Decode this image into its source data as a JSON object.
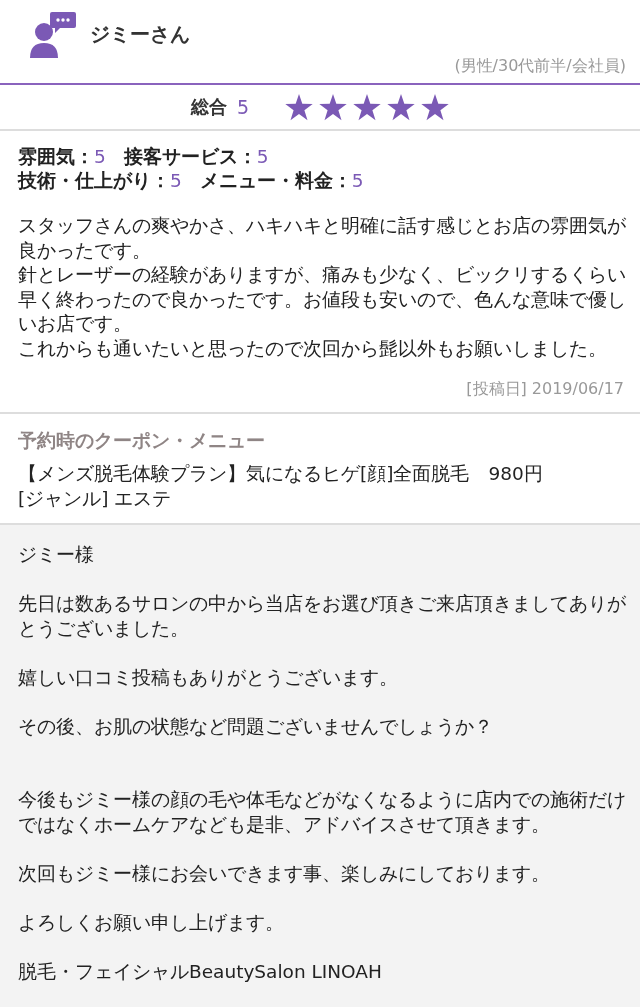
{
  "reviewer": {
    "name": "ジミーさん",
    "profile": "(男性/30代前半/会社員)"
  },
  "overall": {
    "label": "総合",
    "score": "5",
    "stars": 5
  },
  "ratings": [
    {
      "label": "雰囲気：",
      "value": "5"
    },
    {
      "label": "接客サービス：",
      "value": "5"
    },
    {
      "label": "技術・仕上がり：",
      "value": "5"
    },
    {
      "label": "メニュー・料金：",
      "value": "5"
    }
  ],
  "review": {
    "paragraphs": [
      "スタッフさんの爽やかさ、ハキハキと明確に話す感じとお店の雰囲気が良かったです。",
      "針とレーザーの経験がありますが、痛みも少なく、ビックリするくらい早く終わったので良かったです。お値段も安いので、色んな意味で優しいお店です。",
      "これからも通いたいと思ったので次回から髭以外もお願いしました。"
    ],
    "posted_label": "[投稿日]",
    "posted_date": "2019/06/17"
  },
  "coupon": {
    "heading": "予約時のクーポン・メニュー",
    "menu": "【メンズ脱毛体験プラン】気になるヒゲ[顔]全面脱毛　980円",
    "genre": "[ジャンル] エステ"
  },
  "reply": {
    "paragraphs": [
      "ジミー様",
      "先日は数あるサロンの中から当店をお選び頂きご来店頂きましてありがとうございました。",
      "嬉しい口コミ投稿もありがとうございます。",
      "その後、お肌の状態など問題ございませんでしょうか？",
      "今後もジミー様の顔の毛や体毛などがなくなるように店内での施術だけではなくホームケアなども是非、アドバイスさせて頂きます。",
      "次回もジミー様にお会いできます事、楽しみにしております。",
      "よろしくお願い申し上げます。",
      "脱毛・フェイシャルBeautySalon LINOAH"
    ]
  }
}
